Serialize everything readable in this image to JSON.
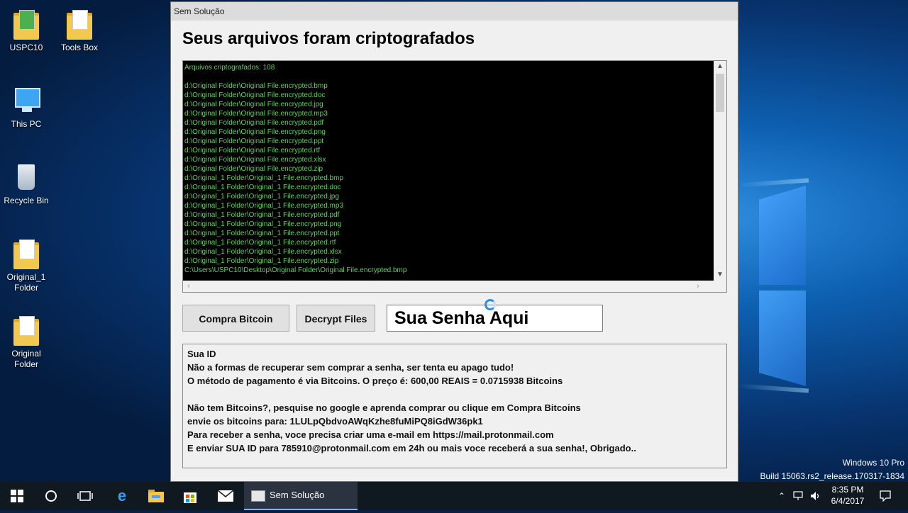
{
  "desktop": {
    "icons": [
      {
        "label": "USPC10"
      },
      {
        "label": "Tools Box"
      },
      {
        "label": "This PC"
      },
      {
        "label": "Recycle Bin"
      },
      {
        "label": "Original_1\nFolder"
      },
      {
        "label": "Original\nFolder"
      }
    ],
    "watermark": {
      "edition": "Windows 10 Pro",
      "build": "Build 15063.rs2_release.170317-1834"
    }
  },
  "window": {
    "title": "Sem Solução",
    "heading": "Seus arquivos foram criptografados",
    "console_lines": [
      "Arquivos criptografados: 108",
      "",
      "d:\\Original Folder\\Original File.encrypted.bmp",
      "d:\\Original Folder\\Original File.encrypted.doc",
      "d:\\Original Folder\\Original File.encrypted.jpg",
      "d:\\Original Folder\\Original File.encrypted.mp3",
      "d:\\Original Folder\\Original File.encrypted.pdf",
      "d:\\Original Folder\\Original File.encrypted.png",
      "d:\\Original Folder\\Original File.encrypted.ppt",
      "d:\\Original Folder\\Original File.encrypted.rtf",
      "d:\\Original Folder\\Original File.encrypted.xlsx",
      "d:\\Original Folder\\Original File.encrypted.zip",
      "d:\\Original_1 Folder\\Original_1 File.encrypted.bmp",
      "d:\\Original_1 Folder\\Original_1 File.encrypted.doc",
      "d:\\Original_1 Folder\\Original_1 File.encrypted.jpg",
      "d:\\Original_1 Folder\\Original_1 File.encrypted.mp3",
      "d:\\Original_1 Folder\\Original_1 File.encrypted.pdf",
      "d:\\Original_1 Folder\\Original_1 File.encrypted.png",
      "d:\\Original_1 Folder\\Original_1 File.encrypted.ppt",
      "d:\\Original_1 Folder\\Original_1 File.encrypted.rtf",
      "d:\\Original_1 Folder\\Original_1 File.encrypted.xlsx",
      "d:\\Original_1 Folder\\Original_1 File.encrypted.zip",
      "C:\\Users\\USPC10\\Desktop\\Original Folder\\Original File.encrypted.bmp"
    ],
    "buttons": {
      "buy": "Compra Bitcoin",
      "decrypt": "Decrypt Files"
    },
    "password_value": "Sua Senha Aqui",
    "info_lines": [
      "Sua ID",
      "Não a formas de recuperar sem comprar a senha, ser tenta eu apago tudo!",
      "O método de pagamento é via Bitcoins.  O preço é: 600,00 REAIS = 0.0715938 Bitcoins",
      "",
      "Não tem Bitcoins?, pesquise no google e aprenda comprar ou clique em Compra Bitcoins",
      "envie os bitcoins para: 1LULpQbdvoAWqKzhe8fuMiPQ8iGdW36pk1",
      "Para receber a senha, voce precisa criar uma e-mail em https://mail.protonmail.com",
      "E enviar SUA ID para 785910@protonmail.com em 24h ou mais voce receberá a sua senha!, Obrigado.."
    ]
  },
  "taskbar": {
    "app_label": "Sem Solução",
    "time": "8:35 PM",
    "date": "6/4/2017"
  }
}
